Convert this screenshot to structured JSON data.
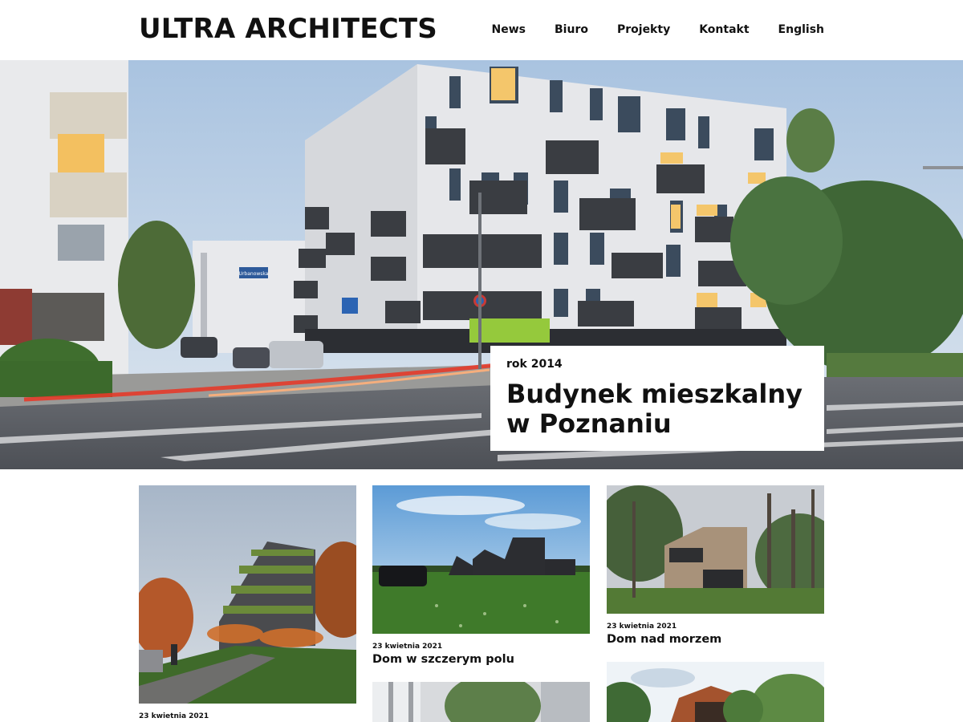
{
  "header": {
    "logo": "ULTRA ARCHITECTS",
    "nav": [
      "News",
      "Biuro",
      "Projekty",
      "Kontakt",
      "English"
    ]
  },
  "hero": {
    "year_label": "rok 2014",
    "title_line1": "Budynek mieszkalny",
    "title_line2": "w Poznaniu",
    "street_sign": "Urbanowska"
  },
  "projects": [
    {
      "date": "23 kwietnia 2021",
      "title": ""
    },
    {
      "date": "23 kwietnia 2021",
      "title": "Dom w szczerym polu"
    },
    {
      "date": "23 kwietnia 2021",
      "title": "Dom nad morzem"
    }
  ],
  "colors": {
    "text": "#111111",
    "background": "#ffffff",
    "sky": "#c9d9ea",
    "grass": "#3f7a2a"
  }
}
